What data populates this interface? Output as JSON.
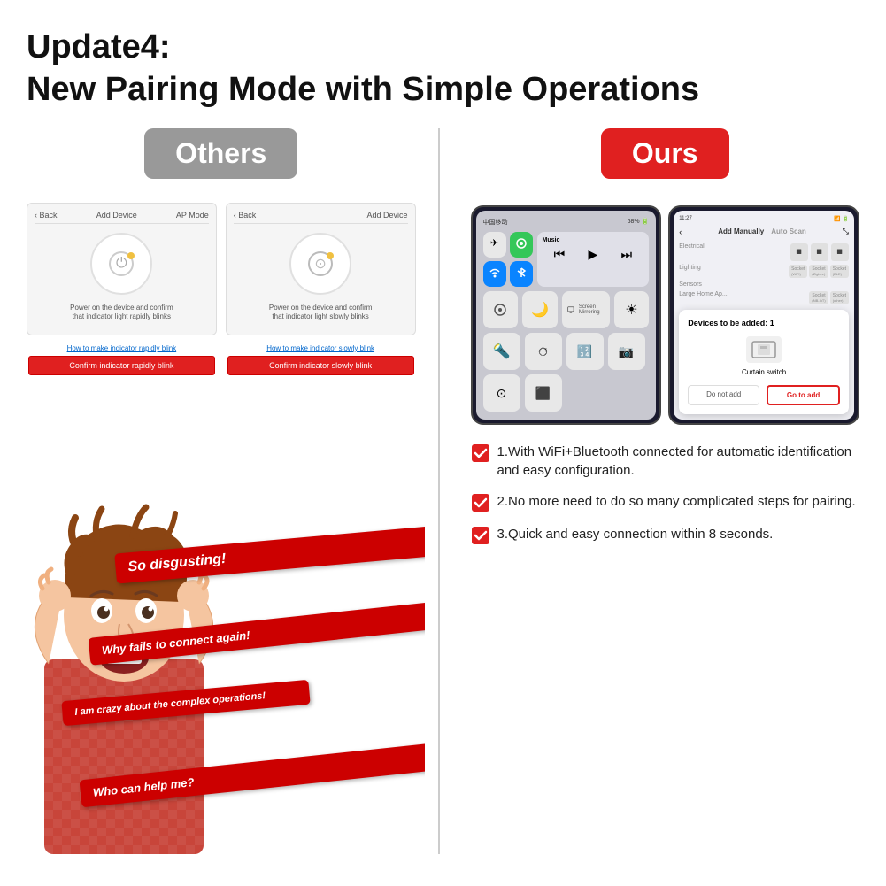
{
  "header": {
    "line1": "Update4:",
    "line2": "New Pairing Mode with Simple Operations"
  },
  "left": {
    "badge": "Others",
    "screenshot1": {
      "nav": [
        "< Back",
        "Add Device",
        "AP Mode"
      ],
      "caption": "Power on the device and confirm\nthat indicator light rapidly blinks",
      "link": "How to make indicator rapidly blink",
      "btn": "Confirm indicator rapidly blink"
    },
    "screenshot2": {
      "nav": [
        "< Back",
        "Add Device"
      ],
      "caption": "Power on the device and confirm\nthat indicator light slowly blinks",
      "link": "How to make indicator slowly blink",
      "btn": "Confirm indicator slowly blink"
    },
    "bubbles": [
      "So disgusting!",
      "Why fails to connect again!",
      "I am crazy about the complex operations!",
      "Who can help me?"
    ]
  },
  "right": {
    "badge": "Ours",
    "phone_left": {
      "label": "iOS Control Center",
      "buttons": [
        "airplane",
        "wifi-bt",
        "wifi",
        "bluetooth",
        "music",
        "screen-mirror",
        "flashlight",
        "timer",
        "calc",
        "camera",
        "scan",
        "focus"
      ]
    },
    "phone_right": {
      "label": "Add Manually",
      "tab1": "Add Manually",
      "tab2": "Auto Scan",
      "categories": [
        "Electrical",
        "Lighting",
        "Sensors",
        "Large Home Ap..."
      ],
      "sockets": [
        "Socket (WiFi)",
        "Socket (Zigbee)",
        "Socket (BLE)",
        "Socket (NB-IoT)",
        "Socket (other)"
      ],
      "popup": {
        "title": "Devices to be added: 1",
        "device": "Curtain switch",
        "btn_cancel": "Do not add",
        "btn_confirm": "Go to add"
      }
    },
    "features": [
      "1.With WiFi+Bluetooth connected for automatic identification and easy configuration.",
      "2.No more need to do so many complicated steps for pairing.",
      "3.Quick and easy connection within 8 seconds."
    ]
  }
}
